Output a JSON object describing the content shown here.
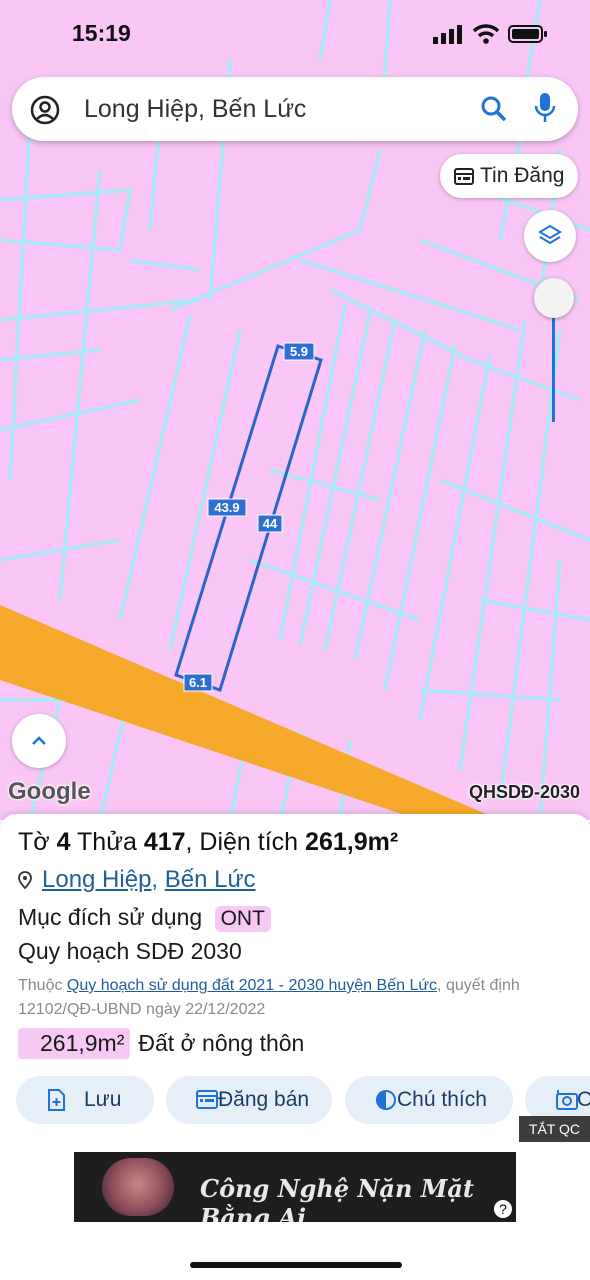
{
  "status_bar": {
    "time": "15:19"
  },
  "search": {
    "query": "Long Hiệp, Bến Lức"
  },
  "map": {
    "tin_dang_label": "Tin Đăng",
    "google_label": "Google",
    "layer_name": "QHSDĐ-2030",
    "edge_labels": {
      "top": "5.9",
      "left": "43.9",
      "right": "44",
      "bottom": "6.1"
    },
    "colors": {
      "land": "#f9c6f6",
      "boundaries": "#a9eaf6",
      "road": "#f7a92b",
      "parcel_outline": "#2a64c4",
      "label_bg": "#2f6fd0"
    }
  },
  "parcel": {
    "title_prefix": "Tờ",
    "sheet": "4",
    "parcel_word": "Thửa",
    "parcel_no": "417",
    "area_word": ", Diện tích",
    "area_value": "261,9m²",
    "location_commune": "Long Hiệp",
    "location_sep": ", ",
    "location_district": "Bến Lức",
    "purpose_label": "Mục đích sử dụng",
    "purpose_code": "ONT",
    "plan_label": "Quy hoạch SDĐ 2030",
    "note_prefix": "Thuộc ",
    "note_link": "Quy hoạch sử dụng đất 2021 - 2030 huyện Bến Lức",
    "note_suffix": ", quyết định 12102/QĐ-UBND ngày 22/12/2022",
    "zone_area": "261,9m²",
    "zone_type": "Đất ở nông thôn"
  },
  "actions": {
    "save": "Lưu",
    "post": "Đăng bán",
    "legend": "Chú thích",
    "capture": "C"
  },
  "ad": {
    "hide_label": "TẮT QC",
    "banner_text": "Công Nghệ Nặn Mặt Bằng Ai",
    "help": "?"
  }
}
